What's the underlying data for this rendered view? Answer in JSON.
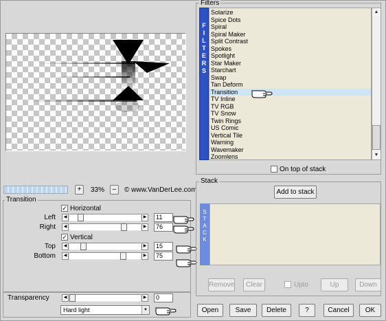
{
  "filters": {
    "legend": "Filters",
    "tab_letters": [
      "F",
      "I",
      "L",
      "T",
      "E",
      "R",
      "S"
    ],
    "items": [
      "Solarize",
      "Spice Dots",
      "Spiral",
      "Spiral Maker",
      "Split Contrast",
      "Spokes",
      "Spotlight",
      "Star Maker",
      "Starchart",
      "Swap",
      "Tan Deform",
      "Transition",
      "TV Inline",
      "TV RGB",
      "TV Snow",
      "Twin Rings",
      "US Comic",
      "Vertical Tile",
      "Warning",
      "Wavemaker",
      "Zoomlens"
    ],
    "selected": "Transition",
    "on_top_label": "On top of stack"
  },
  "zoom": {
    "value": "33%",
    "plus": "+",
    "minus": "–",
    "site": "© www.VanDerLee.com",
    "progress_fraction": 0.25
  },
  "transition": {
    "legend": "Transition",
    "horizontal_label": "Horizontal",
    "vertical_label": "Vertical",
    "left_label": "Left",
    "left_value": "11",
    "right_label": "Right",
    "right_value": "76",
    "top_label": "Top",
    "top_value": "15",
    "bottom_label": "Bottom",
    "bottom_value": "75"
  },
  "blend": {
    "transparency_label": "Transparency",
    "transparency_value": "0",
    "mode": "Hard light"
  },
  "stack": {
    "legend": "Stack",
    "add_label": "Add to stack",
    "tab_letters": [
      "S",
      "T",
      "A",
      "C",
      "K"
    ],
    "remove_label": "Remove",
    "clear_label": "Clear",
    "upto_label": "Upto",
    "up_label": "Up",
    "down_label": "Down"
  },
  "footer": {
    "open_label": "Open",
    "save_label": "Save",
    "delete_label": "Delete",
    "help_label": "?",
    "cancel_label": "Cancel",
    "ok_label": "OK"
  },
  "icons": [
    "pointing-hand-icon",
    "arrow-left-icon",
    "arrow-right-icon",
    "arrow-up-icon",
    "arrow-down-icon",
    "checkmark-icon"
  ]
}
